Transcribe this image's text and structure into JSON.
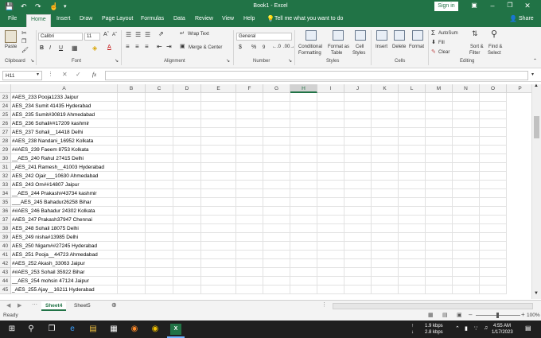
{
  "app": {
    "title": "Book1 - Excel",
    "signin": "Sign in",
    "share": "Share",
    "tell_me": "Tell me what you want to do"
  },
  "tabs": [
    "File",
    "Home",
    "Insert",
    "Draw",
    "Page Layout",
    "Formulas",
    "Data",
    "Review",
    "View",
    "Help"
  ],
  "ribbon": {
    "clipboard": {
      "paste": "Paste",
      "label": "Clipboard"
    },
    "font": {
      "name": "Calibri",
      "size": "11",
      "label": "Font"
    },
    "alignment": {
      "wrap": "Wrap Text",
      "merge": "Merge & Center",
      "label": "Alignment"
    },
    "number": {
      "format": "General",
      "label": "Number"
    },
    "styles": {
      "cond1": "Conditional",
      "cond2": "Formatting",
      "fmt1": "Format as",
      "fmt2": "Table",
      "cell1": "Cell",
      "cell2": "Styles",
      "label": "Styles"
    },
    "cells": {
      "insert": "Insert",
      "delete": "Delete",
      "format": "Format",
      "label": "Cells"
    },
    "editing": {
      "autosum": "AutoSum",
      "fill": "Fill",
      "clear": "Clear",
      "sort1": "Sort &",
      "sort2": "Filter",
      "find1": "Find &",
      "find2": "Select",
      "label": "Editing"
    }
  },
  "formula_bar": {
    "name_box": "H11",
    "fx": "fx"
  },
  "columns": [
    "A",
    "B",
    "C",
    "D",
    "E",
    "F",
    "G",
    "H",
    "I",
    "J",
    "K",
    "L",
    "M",
    "N",
    "O",
    "P"
  ],
  "selected_column": "H",
  "rows": [
    {
      "n": "23",
      "a": "#AES_233 Pooja1233 Jaipur"
    },
    {
      "n": "24",
      "a": "AES_234 Sumit 41435 Hyderabad"
    },
    {
      "n": "25",
      "a": "AES_235 Sumit#30819 Ahmedabad"
    },
    {
      "n": "26",
      "a": "AES_236 Sohail##17209 kashmir"
    },
    {
      "n": "27",
      "a": "AES_237 Sohail__14418 Delhi"
    },
    {
      "n": "28",
      "a": "#AES_238 Nandani_16952 Kolkata"
    },
    {
      "n": "29",
      "a": "##AES_239 Faeem 8753 Kolkata"
    },
    {
      "n": "30",
      "a": "__AES_240 Rahul 27415 Delhi"
    },
    {
      "n": "31",
      "a": "_AES_241 Ramesh__41003 Hyderabad"
    },
    {
      "n": "32",
      "a": "AES_242 Ojair___10630 Ahmedabad"
    },
    {
      "n": "33",
      "a": "AES_243 Om##14807 Jaipur"
    },
    {
      "n": "34",
      "a": "__AES_244 Prakash#43734 kashmir"
    },
    {
      "n": "35",
      "a": "___AES_245 Bahadur26258 Bihar"
    },
    {
      "n": "36",
      "a": "##AES_246 Bahadur 24302 Kolkata"
    },
    {
      "n": "37",
      "a": "#AES_247 Prakash37947 Chennai"
    },
    {
      "n": "38",
      "a": "AES_248 Sohail 18075 Delhi"
    },
    {
      "n": "39",
      "a": "AES_249 nisha#13985 Delhi"
    },
    {
      "n": "40",
      "a": "AES_250 Nigam##27245 Hyderabad"
    },
    {
      "n": "41",
      "a": "AES_251 Pooja__44723 Ahmedabad"
    },
    {
      "n": "42",
      "a": "#AES_252 Akash_33063 Jaipur"
    },
    {
      "n": "43",
      "a": "##AES_253 Sohail 35922 Bihar"
    },
    {
      "n": "44",
      "a": "__AES_254 mohsin 47124 Jaipur"
    },
    {
      "n": "45",
      "a": "_AES_255 Ajay__16211 Hyderabad"
    }
  ],
  "sheets": [
    "Sheet4",
    "Sheet5"
  ],
  "active_sheet": "Sheet4",
  "status": {
    "ready": "Ready",
    "zoom": "100%"
  },
  "taskbar": {
    "net_up": "1.9 kbps",
    "net_down": "2.8 kbps",
    "time": "4:55 AM",
    "date": "1/17/2023"
  },
  "colors": {
    "excel_green": "#217346",
    "ribbon_bg": "#f3f3f3",
    "taskbar_bg": "#1f1f1f"
  }
}
